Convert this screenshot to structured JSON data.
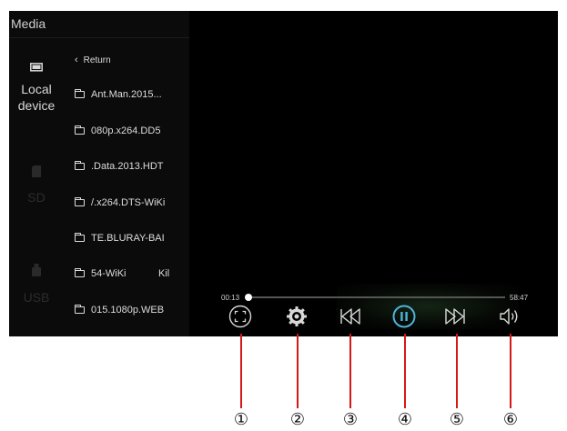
{
  "sidebar": {
    "title": "Media",
    "sources": [
      {
        "label": "Local device",
        "icon": "monitor-icon",
        "active": true
      },
      {
        "label": "SD",
        "icon": "sd-card-icon",
        "active": false
      },
      {
        "label": "USB",
        "icon": "usb-icon",
        "active": false
      }
    ]
  },
  "file_list": {
    "return_label": "Return",
    "items": [
      "Ant.Man.2015...",
      "080p.x264.DD5",
      ".Data.2013.HDT",
      "/.x264.DTS-WiKi",
      "TE.BLURAY-BAI",
      "54-WiKi",
      "015.1080p.WEB"
    ],
    "extra_text": "Kil"
  },
  "player": {
    "current_time": "00:13",
    "total_time": "58:47",
    "progress": 0.004,
    "controls": [
      {
        "name": "fullscreen-button",
        "icon": "fullscreen-icon",
        "callout": "①"
      },
      {
        "name": "settings-button",
        "icon": "gear-icon",
        "callout": "②"
      },
      {
        "name": "previous-button",
        "icon": "skip-previous-icon",
        "callout": "③"
      },
      {
        "name": "pause-button",
        "icon": "pause-icon",
        "callout": "④"
      },
      {
        "name": "next-button",
        "icon": "skip-next-icon",
        "callout": "⑤"
      },
      {
        "name": "volume-button",
        "icon": "volume-icon",
        "callout": "⑥"
      }
    ],
    "accent_color": "#4fb3d9",
    "callout_line_color": "#d51818"
  }
}
